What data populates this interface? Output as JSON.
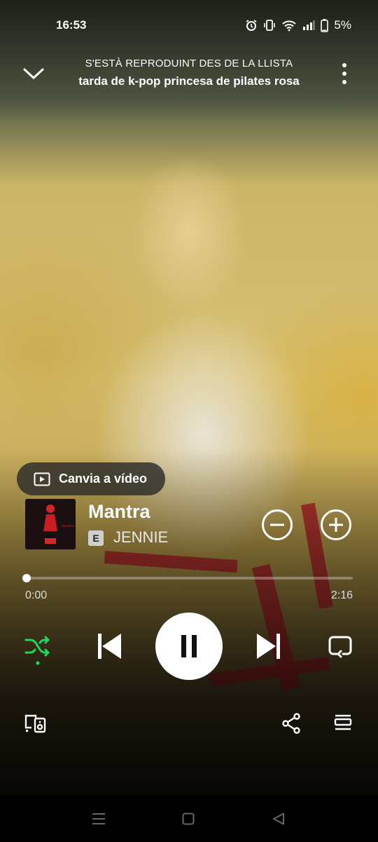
{
  "status_bar": {
    "time": "16:53",
    "battery": "5%",
    "icons": [
      "alarm-icon",
      "vibrate-icon",
      "wifi-icon",
      "signal-icon",
      "battery-icon"
    ]
  },
  "header": {
    "context_label": "S'ESTÀ REPRODUINT DES DE LA LLISTA",
    "playlist_name": "tarda de k-pop princesa de pilates rosa"
  },
  "canvas_button": {
    "label": "Canvia a vídeo"
  },
  "track": {
    "title": "Mantra",
    "explicit_badge": "E",
    "artist": "JENNIE"
  },
  "progress": {
    "current": "0:00",
    "total": "2:16",
    "fraction": 0.0
  },
  "controls": {
    "shuffle_active": true,
    "accent_color": "#1ed760",
    "state": "playing"
  },
  "bottom_actions": [
    "devices-icon",
    "share-icon",
    "queue-icon"
  ],
  "system_nav": [
    "recents-icon",
    "home-icon",
    "back-icon"
  ]
}
